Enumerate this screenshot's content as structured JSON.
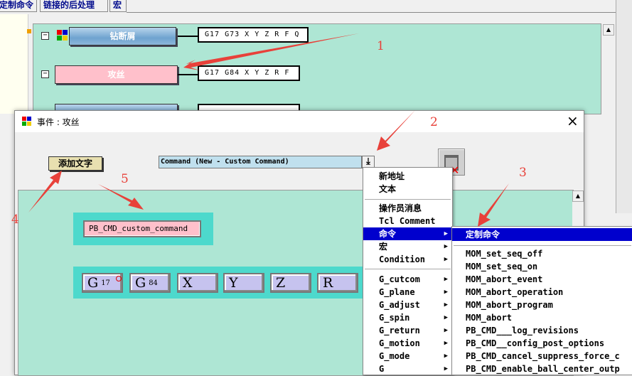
{
  "top_tabs": [
    "定制命令",
    "链接的后处理",
    "宏"
  ],
  "bg_events": [
    {
      "label": "钻断屑",
      "command": "G17 G73 X Y Z R F Q"
    },
    {
      "label": "攻丝",
      "command": "G17 G84 X Y Z R F"
    },
    {
      "label": "",
      "command": ""
    }
  ],
  "dialog": {
    "title": "事件 : 攻丝",
    "close": "×",
    "add_text_button": "添加文字",
    "command_select": "Command (New - Custom Command)",
    "custom_block": "PB_CMD_custom_command",
    "address_chips": [
      {
        "label": "G",
        "sub": "17"
      },
      {
        "label": "G",
        "sub": "84"
      },
      {
        "label": "X",
        "sub": ""
      },
      {
        "label": "Y",
        "sub": ""
      },
      {
        "label": "Z",
        "sub": ""
      },
      {
        "label": "R",
        "sub": ""
      }
    ]
  },
  "dropdown_menu": {
    "items": [
      {
        "label": "新地址",
        "submenu": false
      },
      {
        "label": "文本",
        "submenu": false
      },
      {
        "label": "操作员消息",
        "submenu": false
      },
      {
        "label": "Tcl Comment",
        "submenu": false
      },
      {
        "label": "命令",
        "submenu": true
      },
      {
        "label": "宏",
        "submenu": true
      },
      {
        "label": "Condition",
        "submenu": true
      },
      {
        "label": "G_cutcom",
        "submenu": true
      },
      {
        "label": "G_plane",
        "submenu": true
      },
      {
        "label": "G_adjust",
        "submenu": true
      },
      {
        "label": "G_spin",
        "submenu": true
      },
      {
        "label": "G_return",
        "submenu": true
      },
      {
        "label": "G_motion",
        "submenu": true
      },
      {
        "label": "G_mode",
        "submenu": true
      },
      {
        "label": "G",
        "submenu": true
      }
    ]
  },
  "submenu": {
    "items": [
      "定制命令",
      "MOM_set_seq_off",
      "MOM_set_seq_on",
      "MOM_abort_event",
      "MOM_abort_operation",
      "MOM_abort_program",
      "MOM_abort",
      "PB_CMD___log_revisions",
      "PB_CMD__config_post_options",
      "PB_CMD_cancel_suppress_force_c",
      "PB_CMD_enable_ball_center_outp"
    ]
  },
  "annotations": [
    "1",
    "2",
    "3",
    "4",
    "5"
  ],
  "colors": {
    "canvas": "#aee6d4",
    "accent": "#4dd9cc",
    "menu_highlight": "#0000cd",
    "annotation": "#e8413a"
  }
}
